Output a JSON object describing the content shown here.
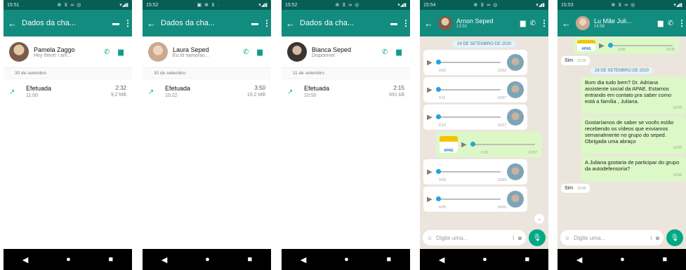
{
  "phones": [
    {
      "status_time": "15:51",
      "status_icons": "⊕ ⊻ ∞ ◎",
      "status_right": "▾◢▮",
      "title": "Dados da cha...",
      "contact": {
        "name": "Pamela Zaggo",
        "status": "Hey there! I am..."
      },
      "date_header": "30 de setembro",
      "call": {
        "type": "Efetuada",
        "time": "11:00",
        "duration": "2:32",
        "size": "9,2 MB"
      }
    },
    {
      "status_time": "15:52",
      "status_icons": "▣ ⊕ ⊻ ·",
      "status_right": "▾◢▮",
      "title": "Dados da cha...",
      "contact": {
        "name": "Laura Seped",
        "status": "Eu tô namoran..."
      },
      "date_header": "30 de setembro",
      "call": {
        "type": "Efetuada",
        "time": "10:22",
        "duration": "3:50",
        "size": "10,2 MB"
      }
    },
    {
      "status_time": "15:52",
      "status_icons": "⊕ ⊻ ∞ ◎",
      "status_right": "▾◢▮",
      "title": "Dados da cha...",
      "contact": {
        "name": "Bianca Seped",
        "status": "Disponível"
      },
      "date_header": "11 de setembro",
      "call": {
        "type": "Efetuada",
        "time": "10:50",
        "duration": "2:15",
        "size": "691 kB"
      }
    }
  ],
  "chat1": {
    "status_time": "15:54",
    "status_icons": "⊕ ⊻ ∞ ◎",
    "status_right": "▾◢▮",
    "name": "Arnon Seped",
    "subtitle": "13:52",
    "date_pill": "24 DE SETEMBRO DE 2020",
    "voices": [
      {
        "dur": "0:02",
        "time": "13:53"
      },
      {
        "dur": "0:11",
        "time": "13:57"
      },
      {
        "dur": "0:10",
        "time": "13:57"
      },
      {
        "dur": "0:15",
        "time": "13:57",
        "out": true,
        "logo": "APAE"
      },
      {
        "dur": "0:03",
        "time": "13:59"
      },
      {
        "dur": "0:05",
        "time": "14:00"
      }
    ],
    "input_placeholder": "Digite uma..."
  },
  "chat2": {
    "status_time": "15:53",
    "status_icons": "⊕ ⊻ ∞ ◎",
    "status_right": "▾◢▮",
    "name": "Lu Mãe Juli...",
    "subtitle": "14:58",
    "top_voice": {
      "dur": "0:06",
      "time": "13:30",
      "logo": "APAE"
    },
    "msg_sim1": {
      "text": "Sim",
      "time": "13:30"
    },
    "date_pill": "29 DE SETEMBRO DE 2020",
    "out_msgs": [
      {
        "text": "Bom dia tudo bem? Dr. Adriana assistente social da APAE. Estamos entrando em contato pra saber como está a família , Juliana.",
        "time": "10:54"
      },
      {
        "text": "Gostaríamos de saber se vocês estão recebendo os vídeos que enviamos semanalmente no grupo do seped. Obrigada uma abraço",
        "time": "10:55"
      },
      {
        "text": "A Juliana gostaria de participar do grupo da autodefensoria?",
        "time": "10:55"
      }
    ],
    "msg_sim2": {
      "text": "Sim",
      "time": "13:40"
    },
    "input_placeholder": "Digite uma..."
  },
  "nav": {
    "back": "◀",
    "home": "●",
    "recents": "■"
  },
  "icons": {
    "back_arrow": "←",
    "phone": "✆",
    "video": "▆",
    "menu": "⋮",
    "call_out": "↗",
    "emoji": "☺",
    "attach": "⌇",
    "camera": "◙",
    "mic": "🎙",
    "play": "▶",
    "scroll": "⌄"
  }
}
